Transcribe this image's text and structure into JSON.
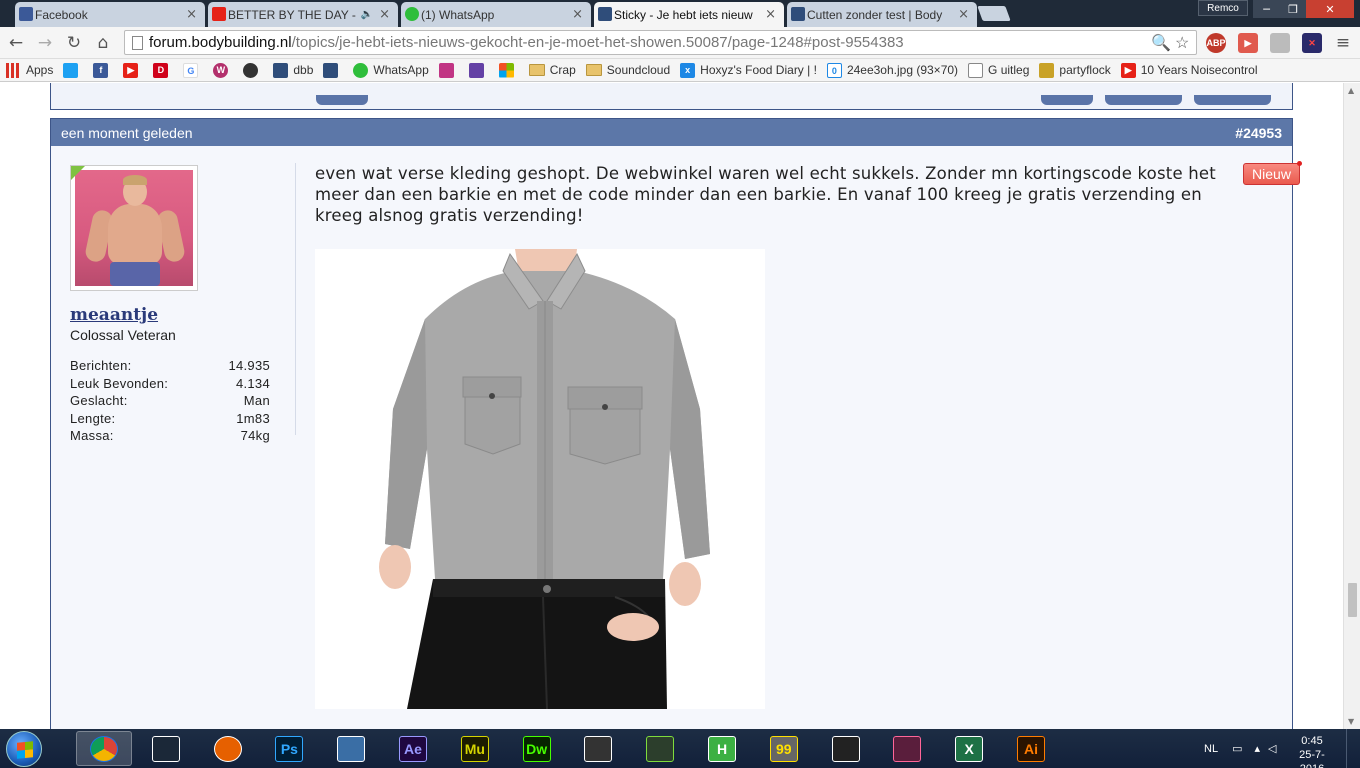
{
  "tabs": [
    {
      "label": "Facebook",
      "color": "#3b5998"
    },
    {
      "label": "BETTER BY THE DAY - I",
      "color": "#e62117"
    },
    {
      "label": "(1) WhatsApp",
      "color": "#2fbe3b"
    },
    {
      "label": "Sticky - Je hebt iets nieuw",
      "color": "#2f4d7a"
    },
    {
      "label": "Cutten zonder test | Body",
      "color": "#2f4d7a"
    }
  ],
  "tab_close": "×",
  "user_button": "Remco",
  "address": {
    "host": "forum.bodybuilding.nl",
    "path": "/topics/je-hebt-iets-nieuws-gekocht-en-je-moet-het-showen.50087/page-1248#post-9554383"
  },
  "bookmarks": [
    {
      "label": "Apps",
      "icon": "apps-grid-icon",
      "color": "#d93025"
    },
    {
      "label": "",
      "icon": "twitter-icon",
      "color": "#1da1f2"
    },
    {
      "label": "",
      "icon": "facebook-icon",
      "color": "#3b5998"
    },
    {
      "label": "",
      "icon": "youtube-icon",
      "color": "#e62117"
    },
    {
      "label": "",
      "icon": "dumpert-icon",
      "color": "#d0021b"
    },
    {
      "label": "",
      "icon": "google-icon",
      "color": "#4285f4"
    },
    {
      "label": "",
      "icon": "scrobble-icon",
      "color": "#b3306c"
    },
    {
      "label": "",
      "icon": "bodybuilding-icon",
      "color": "#333333"
    },
    {
      "label": "dbb",
      "icon": "forum-icon",
      "color": "#2f4d7a"
    },
    {
      "label": "",
      "icon": "forum-icon",
      "color": "#2f4d7a"
    },
    {
      "label": "WhatsApp",
      "icon": "whatsapp-icon",
      "color": "#2fbe3b"
    },
    {
      "label": "",
      "icon": "instagram-icon",
      "color": "#c13584"
    },
    {
      "label": "",
      "icon": "twitch-icon",
      "color": "#6441a5"
    },
    {
      "label": "",
      "icon": "windows-icon",
      "color": "#f25022"
    },
    {
      "label": "Crap",
      "icon": "folder-icon",
      "color": "#e8c36b"
    },
    {
      "label": "Soundcloud",
      "icon": "folder-icon",
      "color": "#e8c36b"
    },
    {
      "label": "Hoxyz's Food Diary | !",
      "icon": "fooddiary-icon",
      "color": "#1e88e5"
    },
    {
      "label": "24ee3oh.jpg (93×70)",
      "icon": "image-icon",
      "color": "#1e88e5"
    },
    {
      "label": "G uitleg",
      "icon": "document-icon",
      "color": "#ffffff"
    },
    {
      "label": "partyflock",
      "icon": "partyflock-icon",
      "color": "#c9a227"
    },
    {
      "label": "10 Years Noisecontrol",
      "icon": "youtube-icon",
      "color": "#e62117"
    }
  ],
  "post": {
    "time": "een moment geleden",
    "number": "#24953",
    "username": "meaantje",
    "user_title": "Colossal Veteran",
    "stats": [
      {
        "label": "Berichten:",
        "value": "14.935"
      },
      {
        "label": "Leuk Bevonden:",
        "value": "4.134"
      },
      {
        "label": "Geslacht:",
        "value": "Man"
      },
      {
        "label": "Lengte:",
        "value": "1m83"
      },
      {
        "label": "Massa:",
        "value": "74kg"
      }
    ],
    "body": "even wat verse kleding geshopt. De webwinkel waren wel echt sukkels. Zonder mn kortingscode koste het meer dan een barkie en met de code minder dan een barkie. En vanaf 100 kreeg je gratis verzending en kreeg alsnog gratis verzending!",
    "badge": "Nieuw"
  },
  "taskbar": {
    "apps": [
      {
        "name": "chrome",
        "label": "",
        "bg": "#ffffff",
        "fg": "#1a73e8",
        "active": true
      },
      {
        "name": "steam",
        "label": "",
        "bg": "#1b2838",
        "fg": "#ffffff",
        "active": false
      },
      {
        "name": "firefox",
        "label": "",
        "bg": "#e66000",
        "fg": "#ffffff",
        "active": false
      },
      {
        "name": "photoshop",
        "label": "Ps",
        "bg": "#001e36",
        "fg": "#31a8ff",
        "active": false
      },
      {
        "name": "network",
        "label": "",
        "bg": "#3a6ea5",
        "fg": "#ffffff",
        "active": false
      },
      {
        "name": "after-effects",
        "label": "Ae",
        "bg": "#1f0740",
        "fg": "#9999ff",
        "active": false
      },
      {
        "name": "muse",
        "label": "Mu",
        "bg": "#1c1c00",
        "fg": "#d4d400",
        "active": false
      },
      {
        "name": "dreamweaver",
        "label": "Dw",
        "bg": "#072401",
        "fg": "#46ff00",
        "active": false
      },
      {
        "name": "media",
        "label": "",
        "bg": "#333333",
        "fg": "#ffffff",
        "active": false
      },
      {
        "name": "fl-studio",
        "label": "",
        "bg": "#2c3e2c",
        "fg": "#7fdc3c",
        "active": false
      },
      {
        "name": "hammer",
        "label": "H",
        "bg": "#3cb043",
        "fg": "#ffffff",
        "active": false
      },
      {
        "name": "notepad",
        "label": "99",
        "bg": "#666666",
        "fg": "#ffe000",
        "active": false
      },
      {
        "name": "recorder",
        "label": "",
        "bg": "#222222",
        "fg": "#ffffff",
        "active": false
      },
      {
        "name": "game",
        "label": "",
        "bg": "#5a1e3c",
        "fg": "#ff6699",
        "active": false
      },
      {
        "name": "excel",
        "label": "X",
        "bg": "#1e7145",
        "fg": "#ffffff",
        "active": false
      },
      {
        "name": "illustrator",
        "label": "Ai",
        "bg": "#2a1300",
        "fg": "#ff7c00",
        "active": false
      }
    ],
    "language": "NL",
    "time": "0:45",
    "date": "25-7-2016"
  }
}
